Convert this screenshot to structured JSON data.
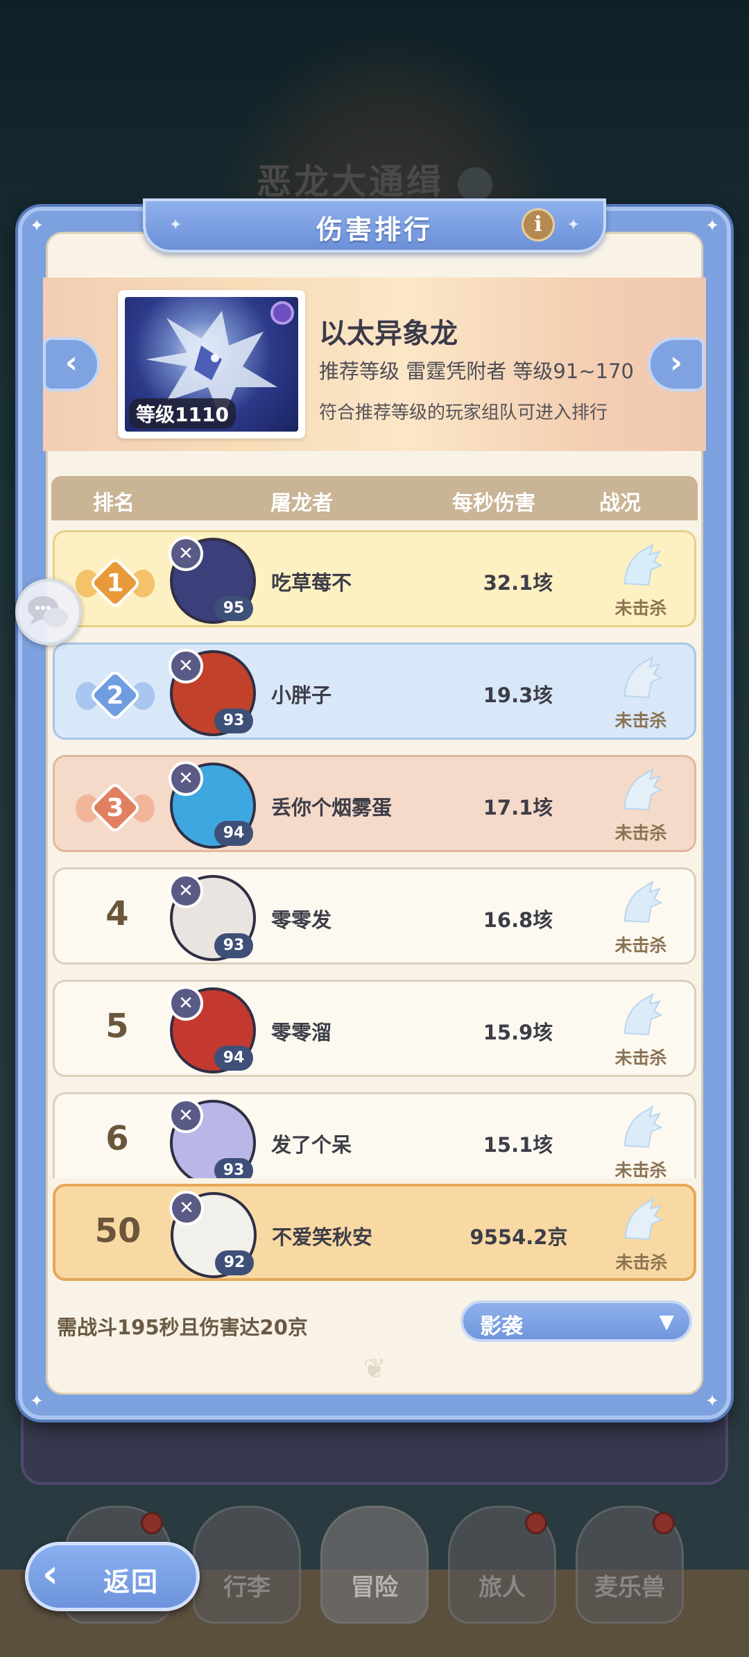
{
  "background": {
    "event_title": "恶龙大通缉"
  },
  "panel": {
    "title": "伤害排行"
  },
  "boss": {
    "level_label": "等级1110",
    "name": "以太异象龙",
    "requirement": "推荐等级  雷霆凭附者  等级91~170",
    "note": "符合推荐等级的玩家组队可进入排行"
  },
  "table": {
    "headers": {
      "rank": "排名",
      "player": "屠龙者",
      "dps": "每秒伤害",
      "status": "战况"
    },
    "rows": [
      {
        "rank": "1",
        "level": "95",
        "name": "吃草莓不",
        "dps": "32.1垓",
        "status": "未击杀",
        "avatar_color": "#3b3f7a"
      },
      {
        "rank": "2",
        "level": "93",
        "name": "小胖子",
        "dps": "19.3垓",
        "status": "未击杀",
        "avatar_color": "#c2412a"
      },
      {
        "rank": "3",
        "level": "94",
        "name": "丢你个烟雾蛋",
        "dps": "17.1垓",
        "status": "未击杀",
        "avatar_color": "#3fa7e0"
      },
      {
        "rank": "4",
        "level": "93",
        "name": "零零发",
        "dps": "16.8垓",
        "status": "未击杀",
        "avatar_color": "#e9e4e0"
      },
      {
        "rank": "5",
        "level": "94",
        "name": "零零溜",
        "dps": "15.9垓",
        "status": "未击杀",
        "avatar_color": "#c4392f"
      },
      {
        "rank": "6",
        "level": "93",
        "name": "发了个呆",
        "dps": "15.1垓",
        "status": "未击杀",
        "avatar_color": "#b9b7e6"
      }
    ],
    "self_row": {
      "rank": "50",
      "level": "92",
      "name": "不爱笑秋安",
      "dps": "9554.2京",
      "status": "未击杀",
      "avatar_color": "#f2f0ea"
    }
  },
  "footer": {
    "requirement": "需战斗195秒且伤害达20京",
    "dropdown_value": "影袭"
  },
  "nav": {
    "back_label": "返回",
    "items": [
      "行李",
      "冒险",
      "旅人",
      "麦乐兽"
    ]
  },
  "colors": {
    "panel_blue": "#7da0de",
    "panel_cream": "#f8f3e6",
    "gold_row": "#fdf0c2",
    "silver_row": "#d8e8f8",
    "bronze_row": "#f5d9c9",
    "self_row": "#f9d9a3",
    "medal_gold": "#e89a3a",
    "medal_silver": "#6f9de0",
    "medal_bronze": "#e08060"
  }
}
